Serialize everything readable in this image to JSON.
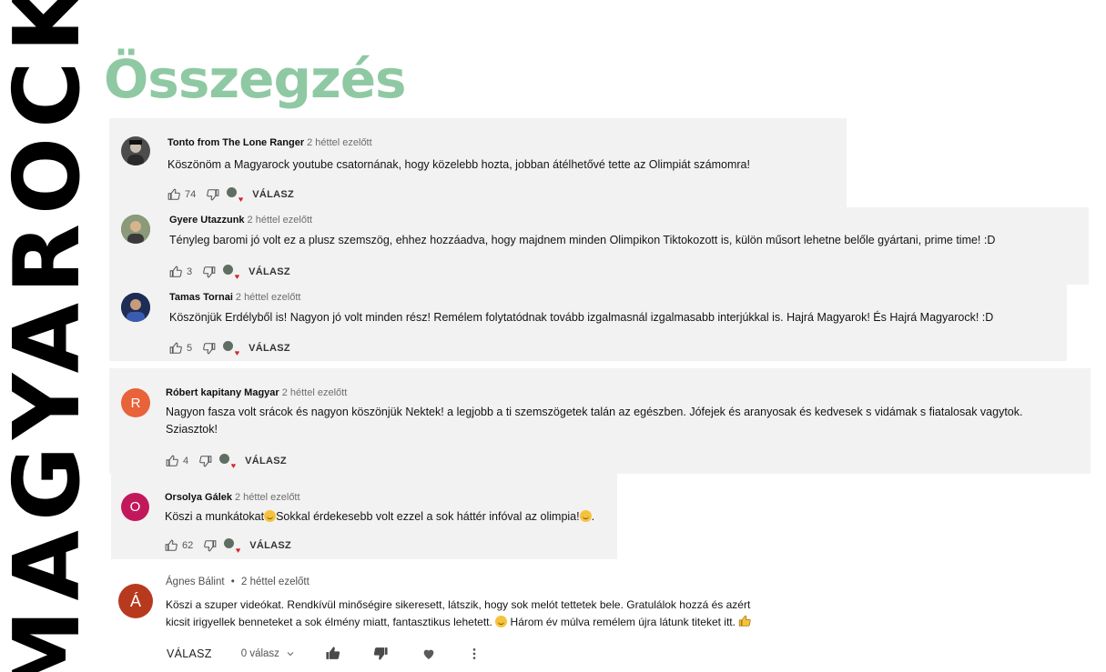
{
  "brand": {
    "vertical_text": "MAGYAROCK"
  },
  "page_title": "Összegzés",
  "comments": [
    {
      "author": "Tonto from The Lone Ranger",
      "time": "2 héttel ezelőtt",
      "text": "Köszönöm a Magyarock youtube csatornának, hogy közelebb hozta, jobban átélhetővé tette az Olimpiát számomra!",
      "likes": "74",
      "reply_label": "VÁLASZ",
      "avatar_initial": "",
      "avatar_color": "#4d4d4d"
    },
    {
      "author": "Gyere Utazzunk",
      "time": "2 héttel ezelőtt",
      "text": "Tényleg baromi jó volt ez a plusz szemszög, ehhez hozzáadva, hogy majdnem minden Olimpikon Tiktokozott is, külön műsort lehetne belőle gyártani, prime time! :D",
      "likes": "3",
      "reply_label": "VÁLASZ",
      "avatar_initial": "",
      "avatar_color": "#7a6a55"
    },
    {
      "author": "Tamas Tornai",
      "time": "2 héttel ezelőtt",
      "text": "Köszönjük Erdélyből is! Nagyon jó volt minden rész! Remélem folytatódnak tovább izgalmasnál izgalmasabb interjúkkal is. Hajrá Magyarok! És Hajrá Magyarock! :D",
      "likes": "5",
      "reply_label": "VÁLASZ",
      "avatar_initial": "",
      "avatar_color": "#2c3f6e"
    },
    {
      "author": "Róbert kapitany Magyar",
      "time": "2 héttel ezelőtt",
      "text_line1": "Nagyon fasza volt srácok és nagyon köszönjük Nektek! a legjobb a ti szemszögetek talán az egészben. Jófejek és aranyosak és kedvesek s vidámak s fiatalosak vagytok.",
      "text_line2": "Sziasztok!",
      "likes": "4",
      "reply_label": "VÁLASZ",
      "avatar_initial": "R",
      "avatar_color": "#e8623a"
    },
    {
      "author": "Orsolya Gálek",
      "time": "2 héttel ezelőtt",
      "text_a": "Köszi a munkátokat",
      "text_b": "Sokkal érdekesebb volt ezzel a sok háttér infóval az olimpia!",
      "text_c": ".",
      "likes": "62",
      "reply_label": "VÁLASZ",
      "avatar_initial": "O",
      "avatar_color": "#c2185b"
    }
  ],
  "last_comment": {
    "author": "Ágnes Bálint",
    "separator": "•",
    "time": "2 héttel ezelőtt",
    "line1": "Köszi a szuper videókat. Rendkívül minőségire sikeresett, látszik, hogy sok melót tettetek bele. Gratulálok hozzá és azért",
    "line2a": "kicsit irigyellek benneteket a sok élmény miatt, fantasztikus lehetett.",
    "line2b": "Három év múlva remélem újra látunk titeket itt.",
    "avatar_initial": "Á",
    "avatar_color": "#b73a1e",
    "reply_label": "VÁLASZ",
    "replies_label": "0 válasz",
    "icons": [
      "chevron-down-icon",
      "thumb-up-icon",
      "thumb-down-icon",
      "heart-icon",
      "more-vert-icon"
    ]
  }
}
